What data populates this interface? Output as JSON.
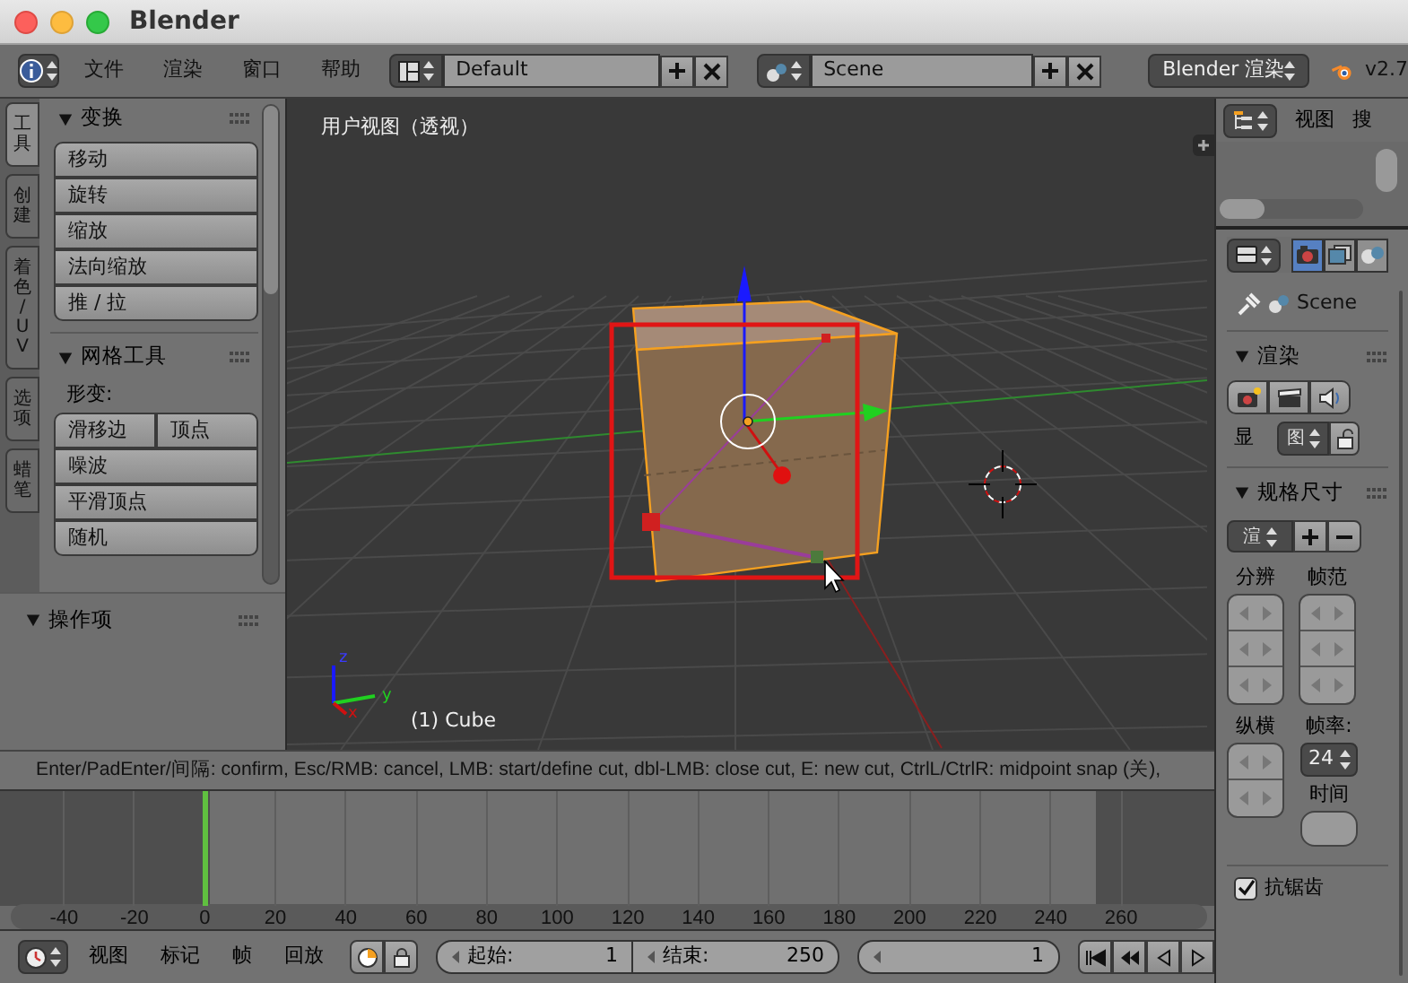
{
  "window": {
    "title": "Blender"
  },
  "header": {
    "menus": [
      "文件",
      "渲染",
      "窗口",
      "帮助"
    ],
    "layout": "Default",
    "scene": "Scene",
    "engine": "Blender 渲染",
    "version": "v2.7"
  },
  "tool_tabs": [
    {
      "label": "工具",
      "selected": true
    },
    {
      "label": "创建",
      "selected": false
    },
    {
      "label": "着色 / UV",
      "selected": false
    },
    {
      "label": "选项",
      "selected": false
    },
    {
      "label": "蜡笔",
      "selected": false
    }
  ],
  "tool_panels": [
    {
      "title": "变换",
      "expanded": true,
      "rows": [
        [
          "移动"
        ],
        [
          "旋转"
        ],
        [
          "缩放"
        ],
        [
          "法向缩放"
        ],
        [
          "推 / 拉"
        ]
      ]
    },
    {
      "title": "网格工具",
      "expanded": true,
      "subtitle": "形变:",
      "rows": [
        [
          "滑移边",
          "顶点"
        ],
        [
          "噪波"
        ],
        [
          "平滑顶点"
        ],
        [
          "随机"
        ]
      ]
    }
  ],
  "operator_panel": {
    "title": "操作项",
    "expanded": true
  },
  "viewport": {
    "title": "用户视图（透视）",
    "object": "(1) Cube",
    "axis_labels": [
      "z",
      "y",
      "x"
    ]
  },
  "status": "Enter/PadEnter/间隔: confirm, Esc/RMB: cancel, LMB: start/define cut, dbl-LMB: close cut, E: new cut, CtrlL/CtrlR: midpoint snap (关),",
  "timeline": {
    "ticks": [
      {
        "label": "-40",
        "current": false
      },
      {
        "label": "-20",
        "current": false
      },
      {
        "label": "0",
        "current": true
      },
      {
        "label": "20",
        "current": false
      },
      {
        "label": "40",
        "current": false
      },
      {
        "label": "60",
        "current": false
      },
      {
        "label": "80",
        "current": false
      },
      {
        "label": "100",
        "current": false
      },
      {
        "label": "120",
        "current": false
      },
      {
        "label": "140",
        "current": false
      },
      {
        "label": "160",
        "current": false
      },
      {
        "label": "180",
        "current": false
      },
      {
        "label": "200",
        "current": false
      },
      {
        "label": "220",
        "current": false
      },
      {
        "label": "240",
        "current": false
      },
      {
        "label": "260",
        "current": false
      }
    ]
  },
  "footer": {
    "menus": [
      "视图",
      "标记",
      "帧",
      "回放"
    ],
    "start_label": "起始:",
    "start": "1",
    "end_label": "结束:",
    "end": "250",
    "frame": "1"
  },
  "outliner": {
    "menu": "视图",
    "search": "搜"
  },
  "properties": {
    "context_tabs": [
      {
        "kind": "camera",
        "selected": true
      },
      {
        "kind": "layers",
        "selected": false
      },
      {
        "kind": "sphere",
        "selected": false
      }
    ],
    "context": "Scene",
    "render_panel": {
      "title": "渲染",
      "expanded": true,
      "display_label": "显",
      "display_value": "图"
    },
    "dimensions_panel": {
      "title": "规格尺寸",
      "expanded": true,
      "preset": "渲",
      "resolution_label": "分辨",
      "frame_range_label": "帧范",
      "aspect_label": "纵横",
      "framerate_label": "帧率:",
      "framerate": "24",
      "time_label": "时间"
    },
    "antialiasing": {
      "label": "抗锯齿",
      "checked": true
    }
  }
}
